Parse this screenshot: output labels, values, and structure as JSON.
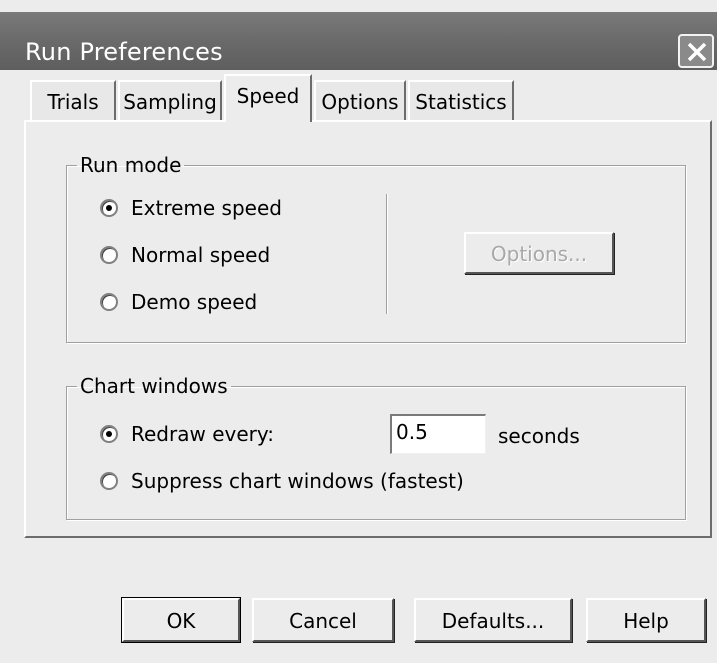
{
  "window": {
    "title": "Run Preferences"
  },
  "tabs": [
    {
      "label": "Trials",
      "active": false
    },
    {
      "label": "Sampling",
      "active": false
    },
    {
      "label": "Speed",
      "active": true
    },
    {
      "label": "Options",
      "active": false
    },
    {
      "label": "Statistics",
      "active": false
    }
  ],
  "run_mode": {
    "legend": "Run mode",
    "options": [
      {
        "label": "Extreme speed",
        "checked": true
      },
      {
        "label": "Normal speed",
        "checked": false
      },
      {
        "label": "Demo speed",
        "checked": false
      }
    ],
    "options_button": "Options..."
  },
  "chart_windows": {
    "legend": "Chart windows",
    "redraw_label": "Redraw every:",
    "redraw_value": "0.5",
    "units": "seconds",
    "suppress_label": "Suppress chart windows (fastest)"
  },
  "buttons": {
    "ok": "OK",
    "cancel": "Cancel",
    "defaults": "Defaults...",
    "help": "Help"
  }
}
